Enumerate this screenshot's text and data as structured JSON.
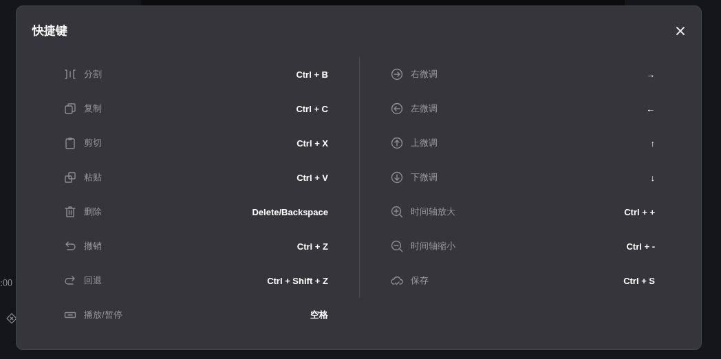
{
  "backdrop": {
    "timecode": ":00"
  },
  "dialog": {
    "title": "快捷键",
    "left_column": [
      {
        "label": "分割",
        "keys": "Ctrl + B"
      },
      {
        "label": "复制",
        "keys": "Ctrl + C"
      },
      {
        "label": "剪切",
        "keys": "Ctrl + X"
      },
      {
        "label": "粘贴",
        "keys": "Ctrl + V"
      },
      {
        "label": "删除",
        "keys": "Delete/Backspace"
      },
      {
        "label": "撤销",
        "keys": "Ctrl + Z"
      },
      {
        "label": "回退",
        "keys": "Ctrl + Shift + Z"
      },
      {
        "label": "播放/暂停",
        "keys": "空格"
      }
    ],
    "right_column": [
      {
        "label": "右微调",
        "keys": "→"
      },
      {
        "label": "左微调",
        "keys": "←"
      },
      {
        "label": "上微调",
        "keys": "↑"
      },
      {
        "label": "下微调",
        "keys": "↓"
      },
      {
        "label": "时间轴放大",
        "keys": "Ctrl + +"
      },
      {
        "label": "时间轴缩小",
        "keys": "Ctrl + -"
      },
      {
        "label": "保存",
        "keys": "Ctrl + S"
      }
    ]
  }
}
